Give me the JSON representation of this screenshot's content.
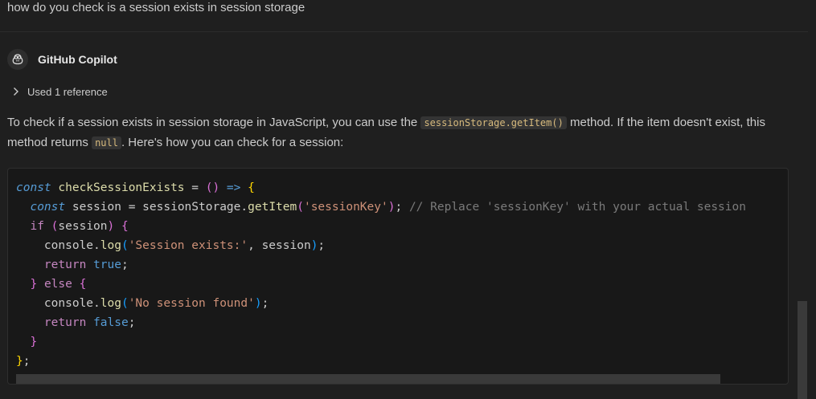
{
  "question": "how do you check is a session exists in session storage",
  "copilot": {
    "name": "GitHub Copilot",
    "avatar_icon": "copilot-icon"
  },
  "references": {
    "label": "Used 1 reference",
    "icon": "chevron-right-icon"
  },
  "answer": {
    "part1": "To check if a session exists in session storage in JavaScript, you can use the ",
    "code1": "sessionStorage.getItem()",
    "part2": " method. If the item doesn't exist, this method returns ",
    "code2": "null",
    "part3": ". Here's how you can check for a session:"
  },
  "code": {
    "language": "javascript",
    "lines": [
      "const checkSessionExists = () => {",
      "  const session = sessionStorage.getItem('sessionKey'); // Replace 'sessionKey' with your actual session",
      "  if (session) {",
      "    console.log('Session exists:', session);",
      "    return true;",
      "  } else {",
      "    console.log('No session found');",
      "    return false;",
      "  }",
      "};"
    ],
    "tokens": {
      "const": "const",
      "checkSessionExists": "checkSessionExists",
      "eq": " = ",
      "parens": "()",
      "arrow": " => ",
      "session": "session",
      "sessionStorage": "sessionStorage",
      "getItem": "getItem",
      "sessionKey_str": "'sessionKey'",
      "comment": "// Replace 'sessionKey' with your actual session",
      "if": "if",
      "console": "console",
      "log": "log",
      "session_exists_str": "'Session exists:'",
      "return": "return",
      "true": "true",
      "else": "else",
      "no_session_str": "'No session found'",
      "false": "false"
    }
  },
  "colors": {
    "background": "#1f1f1f",
    "code_background": "#181818",
    "inline_code_text": "#d7ba7d"
  }
}
